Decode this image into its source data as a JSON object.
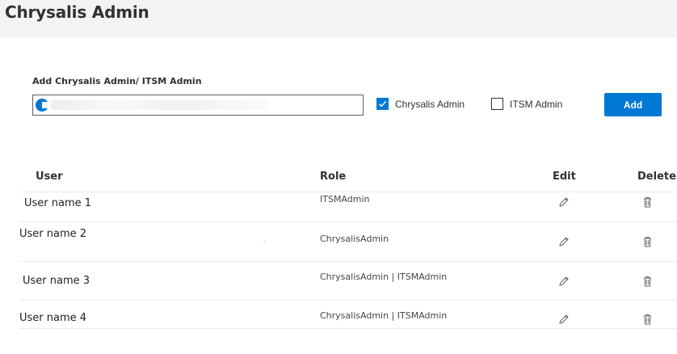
{
  "page": {
    "title": "Chrysalis Admin"
  },
  "form": {
    "section_label": "Add Chrysalis Admin/ ITSM Admin",
    "checkboxes": [
      {
        "label": "Chrysalis Admin",
        "checked": true
      },
      {
        "label": "ITSM Admin",
        "checked": false
      }
    ],
    "add_label": "Add"
  },
  "table": {
    "headers": {
      "user": "User",
      "role": "Role",
      "edit": "Edit",
      "delete": "Delete"
    },
    "rows": [
      {
        "user": "User name 1",
        "role": "ITSMAdmin"
      },
      {
        "user": "User name 2",
        "role": "ChrysalisAdmin"
      },
      {
        "user": "User name 3",
        "role": "ChrysalisAdmin | ITSMAdmin"
      },
      {
        "user": "User name 4",
        "role": "ChrysalisAdmin | ITSMAdmin"
      }
    ]
  },
  "icons": {
    "edit": "pencil-icon",
    "delete": "trash-icon"
  },
  "colors": {
    "accent": "#0078d4"
  }
}
